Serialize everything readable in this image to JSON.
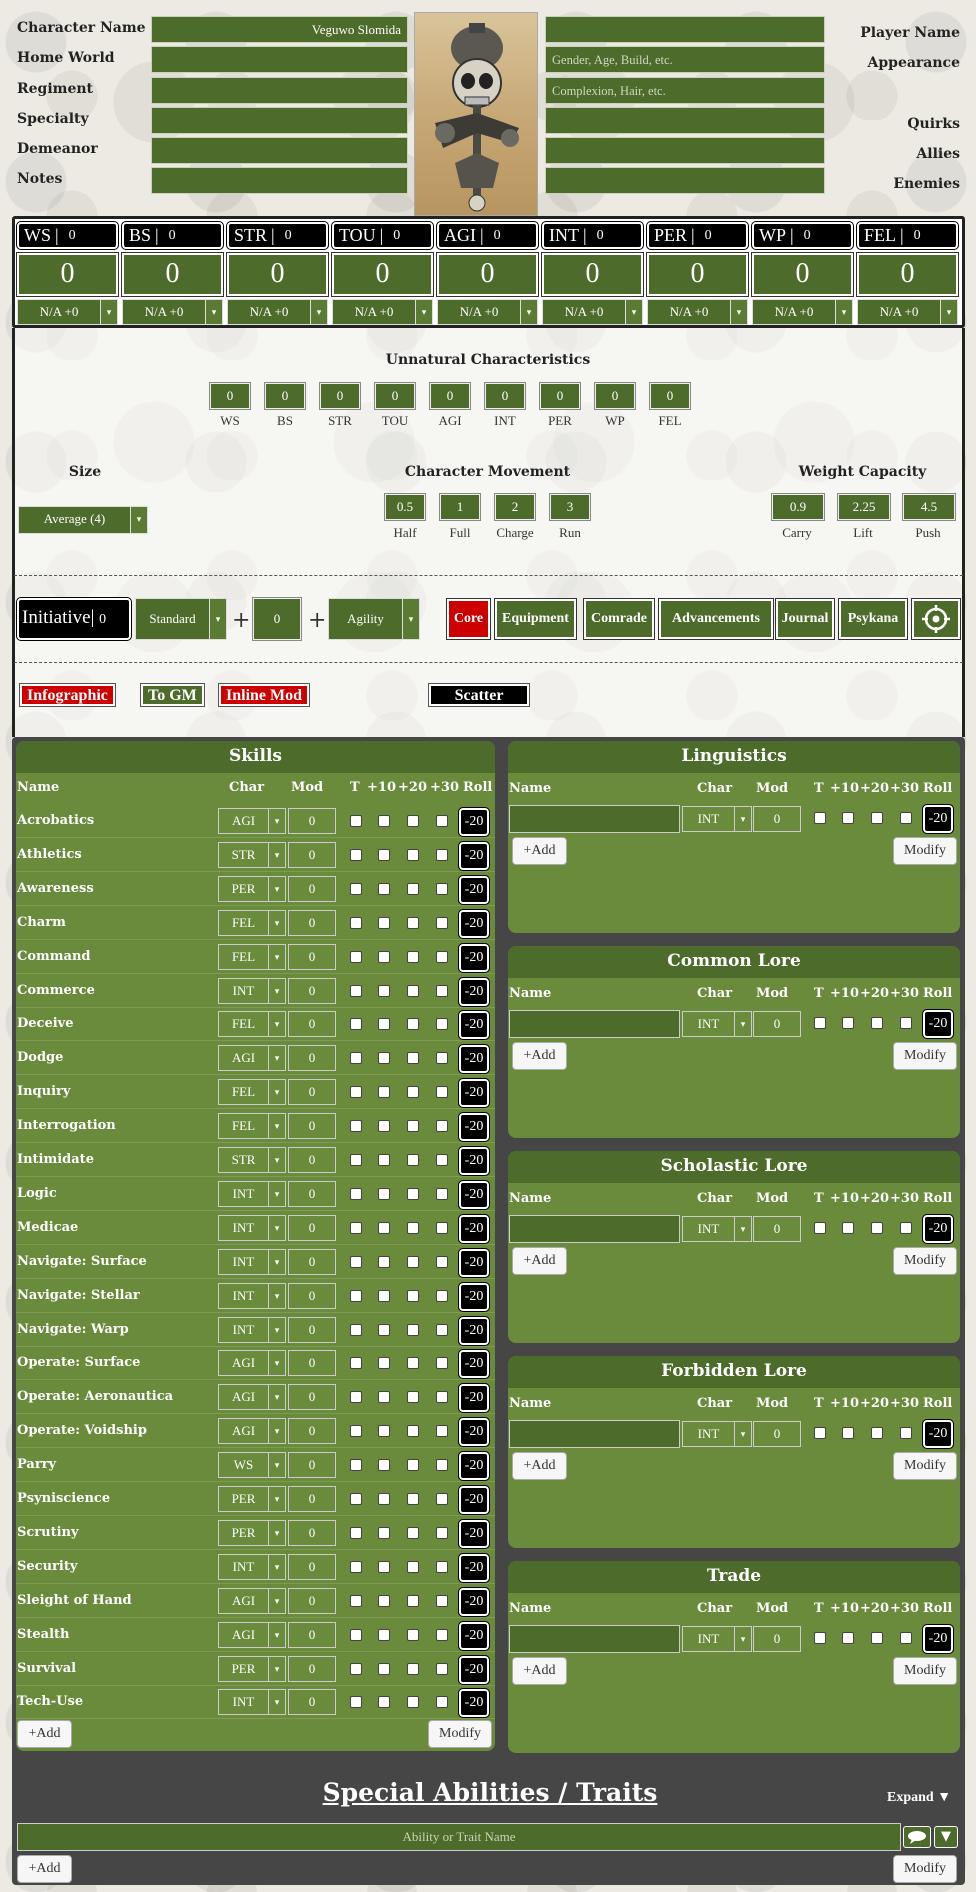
{
  "header": {
    "labels_left": [
      "Character Name",
      "Home World",
      "Regiment",
      "Specialty",
      "Demeanor",
      "Notes"
    ],
    "values_left": [
      "Veguwo Slomida",
      "",
      "",
      "",
      "",
      ""
    ],
    "labels_right": [
      "Player Name",
      "Appearance",
      "",
      "Quirks",
      "Allies",
      "Enemies"
    ],
    "values_right": [
      "",
      "Gender, Age, Build, etc.",
      "Complexion, Hair, etc.",
      "",
      "",
      ""
    ]
  },
  "characteristics": [
    {
      "abbr": "WS",
      "value": "0",
      "total": "0",
      "mod": "N/A +0"
    },
    {
      "abbr": "BS",
      "value": "0",
      "total": "0",
      "mod": "N/A +0"
    },
    {
      "abbr": "STR",
      "value": "0",
      "total": "0",
      "mod": "N/A +0"
    },
    {
      "abbr": "TOU",
      "value": "0",
      "total": "0",
      "mod": "N/A +0"
    },
    {
      "abbr": "AGI",
      "value": "0",
      "total": "0",
      "mod": "N/A +0"
    },
    {
      "abbr": "INT",
      "value": "0",
      "total": "0",
      "mod": "N/A +0"
    },
    {
      "abbr": "PER",
      "value": "0",
      "total": "0",
      "mod": "N/A +0"
    },
    {
      "abbr": "WP",
      "value": "0",
      "total": "0",
      "mod": "N/A +0"
    },
    {
      "abbr": "FEL",
      "value": "0",
      "total": "0",
      "mod": "N/A +0"
    }
  ],
  "unnatural": {
    "title": "Unnatural Characteristics",
    "items": [
      {
        "label": "WS",
        "value": "0"
      },
      {
        "label": "BS",
        "value": "0"
      },
      {
        "label": "STR",
        "value": "0"
      },
      {
        "label": "TOU",
        "value": "0"
      },
      {
        "label": "AGI",
        "value": "0"
      },
      {
        "label": "INT",
        "value": "0"
      },
      {
        "label": "PER",
        "value": "0"
      },
      {
        "label": "WP",
        "value": "0"
      },
      {
        "label": "FEL",
        "value": "0"
      }
    ]
  },
  "size": {
    "title": "Size",
    "value": "Average (4)"
  },
  "movement": {
    "title": "Character Movement",
    "items": [
      {
        "label": "Half",
        "value": "0.5"
      },
      {
        "label": "Full",
        "value": "1"
      },
      {
        "label": "Charge",
        "value": "2"
      },
      {
        "label": "Run",
        "value": "3"
      }
    ]
  },
  "weight": {
    "title": "Weight Capacity",
    "items": [
      {
        "label": "Carry",
        "value": "0.9"
      },
      {
        "label": "Lift",
        "value": "2.25"
      },
      {
        "label": "Push",
        "value": "4.5"
      }
    ]
  },
  "initiative": {
    "label": "Initiative",
    "value": "0",
    "type": "Standard",
    "plus1": "+",
    "bonus": "0",
    "plus2": "+",
    "char": "Agility"
  },
  "tabs": [
    "Core",
    "Equipment",
    "Comrade",
    "Advancements",
    "Journal",
    "Psykana"
  ],
  "toggles": {
    "infographic": "Infographic",
    "to_gm": "To GM",
    "inline_mod": "Inline Mod",
    "scatter": "Scatter"
  },
  "skills": {
    "title": "Skills",
    "cols": [
      "Name",
      "Char",
      "Mod",
      "T",
      "+10",
      "+20",
      "+30",
      "Roll"
    ],
    "rows": [
      {
        "name": "Acrobatics",
        "char": "AGI",
        "mod": "0",
        "roll": "-20"
      },
      {
        "name": "Athletics",
        "char": "STR",
        "mod": "0",
        "roll": "-20"
      },
      {
        "name": "Awareness",
        "char": "PER",
        "mod": "0",
        "roll": "-20"
      },
      {
        "name": "Charm",
        "char": "FEL",
        "mod": "0",
        "roll": "-20"
      },
      {
        "name": "Command",
        "char": "FEL",
        "mod": "0",
        "roll": "-20"
      },
      {
        "name": "Commerce",
        "char": "INT",
        "mod": "0",
        "roll": "-20"
      },
      {
        "name": "Deceive",
        "char": "FEL",
        "mod": "0",
        "roll": "-20"
      },
      {
        "name": "Dodge",
        "char": "AGI",
        "mod": "0",
        "roll": "-20"
      },
      {
        "name": "Inquiry",
        "char": "FEL",
        "mod": "0",
        "roll": "-20"
      },
      {
        "name": "Interrogation",
        "char": "FEL",
        "mod": "0",
        "roll": "-20"
      },
      {
        "name": "Intimidate",
        "char": "STR",
        "mod": "0",
        "roll": "-20"
      },
      {
        "name": "Logic",
        "char": "INT",
        "mod": "0",
        "roll": "-20"
      },
      {
        "name": "Medicae",
        "char": "INT",
        "mod": "0",
        "roll": "-20"
      },
      {
        "name": "Navigate: Surface",
        "char": "INT",
        "mod": "0",
        "roll": "-20"
      },
      {
        "name": "Navigate: Stellar",
        "char": "INT",
        "mod": "0",
        "roll": "-20"
      },
      {
        "name": "Navigate: Warp",
        "char": "INT",
        "mod": "0",
        "roll": "-20"
      },
      {
        "name": "Operate: Surface",
        "char": "AGI",
        "mod": "0",
        "roll": "-20"
      },
      {
        "name": "Operate: Aeronautica",
        "char": "AGI",
        "mod": "0",
        "roll": "-20"
      },
      {
        "name": "Operate: Voidship",
        "char": "AGI",
        "mod": "0",
        "roll": "-20"
      },
      {
        "name": "Parry",
        "char": "WS",
        "mod": "0",
        "roll": "-20"
      },
      {
        "name": "Psyniscience",
        "char": "PER",
        "mod": "0",
        "roll": "-20"
      },
      {
        "name": "Scrutiny",
        "char": "PER",
        "mod": "0",
        "roll": "-20"
      },
      {
        "name": "Security",
        "char": "INT",
        "mod": "0",
        "roll": "-20"
      },
      {
        "name": "Sleight of Hand",
        "char": "AGI",
        "mod": "0",
        "roll": "-20"
      },
      {
        "name": "Stealth",
        "char": "AGI",
        "mod": "0",
        "roll": "-20"
      },
      {
        "name": "Survival",
        "char": "PER",
        "mod": "0",
        "roll": "-20"
      },
      {
        "name": "Tech-Use",
        "char": "INT",
        "mod": "0",
        "roll": "-20"
      }
    ],
    "add": "+Add",
    "modify": "Modify"
  },
  "lore_panels": [
    {
      "title": "Linguistics",
      "char": "INT",
      "mod": "0",
      "roll": "-20"
    },
    {
      "title": "Common Lore",
      "char": "INT",
      "mod": "0",
      "roll": "-20"
    },
    {
      "title": "Scholastic Lore",
      "char": "INT",
      "mod": "0",
      "roll": "-20"
    },
    {
      "title": "Forbidden Lore",
      "char": "INT",
      "mod": "0",
      "roll": "-20"
    },
    {
      "title": "Trade",
      "char": "INT",
      "mod": "0",
      "roll": "-20"
    }
  ],
  "special": {
    "title": "Special Abilities / Traits",
    "expand": "Expand ▼",
    "placeholder": "Ability or Trait Name",
    "add": "+Add",
    "modify": "Modify"
  },
  "colors": {
    "green": "#4d6b2a",
    "panel_green": "#6a8a3c",
    "red": "#cc0000",
    "dark": "#464646"
  }
}
